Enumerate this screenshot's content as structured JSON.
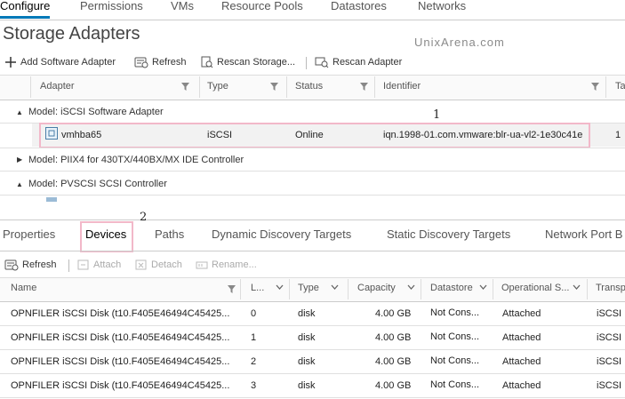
{
  "top_tabs": [
    "Configure",
    "Permissions",
    "VMs",
    "Resource Pools",
    "Datastores",
    "Networks"
  ],
  "page_title": "Storage Adapters",
  "watermark": "UnixArena.com",
  "toolbar": {
    "add": "Add Software Adapter",
    "refresh": "Refresh",
    "rescan_storage": "Rescan Storage...",
    "rescan_adapter": "Rescan Adapter"
  },
  "adapters_table": {
    "headers": [
      "Adapter",
      "Type",
      "Status",
      "Identifier",
      "Ta"
    ],
    "groups": [
      {
        "label": "Model: iSCSI Software Adapter",
        "expanded": true
      },
      {
        "label": "Model: PIIX4 for 430TX/440BX/MX IDE Controller",
        "expanded": false
      },
      {
        "label": "Model: PVSCSI SCSI Controller",
        "expanded": true
      }
    ],
    "row": {
      "adapter": "vmhba65",
      "type": "iSCSI",
      "status": "Online",
      "identifier": "iqn.1998-01.com.vmware:blr-ua-vl2-1e30c41e",
      "targets": "1"
    }
  },
  "annotations": {
    "one": "1",
    "two": "2"
  },
  "bottom_tabs": [
    "Properties",
    "Devices",
    "Paths",
    "Dynamic Discovery Targets",
    "Static Discovery Targets",
    "Network Port B"
  ],
  "devices_toolbar": {
    "refresh": "Refresh",
    "attach": "Attach",
    "detach": "Detach",
    "rename": "Rename..."
  },
  "devices_table": {
    "headers": [
      "Name",
      "L...",
      "Type",
      "Capacity",
      "Datastore",
      "Operational S...",
      "Transp"
    ],
    "rows": [
      [
        "OPNFILER iSCSI Disk (t10.F405E46494C45425...",
        "0",
        "disk",
        "4.00 GB",
        "Not Cons...",
        "Attached",
        "iSCSI"
      ],
      [
        "OPNFILER iSCSI Disk (t10.F405E46494C45425...",
        "1",
        "disk",
        "4.00 GB",
        "Not Cons...",
        "Attached",
        "iSCSI"
      ],
      [
        "OPNFILER iSCSI Disk (t10.F405E46494C45425...",
        "2",
        "disk",
        "4.00 GB",
        "Not Cons...",
        "Attached",
        "iSCSI"
      ],
      [
        "OPNFILER iSCSI Disk (t10.F405E46494C45425...",
        "3",
        "disk",
        "4.00 GB",
        "Not Cons...",
        "Attached",
        "iSCSI"
      ]
    ]
  },
  "colors": {
    "accent": "#0079b8",
    "highlight": "#f2b8c9"
  }
}
